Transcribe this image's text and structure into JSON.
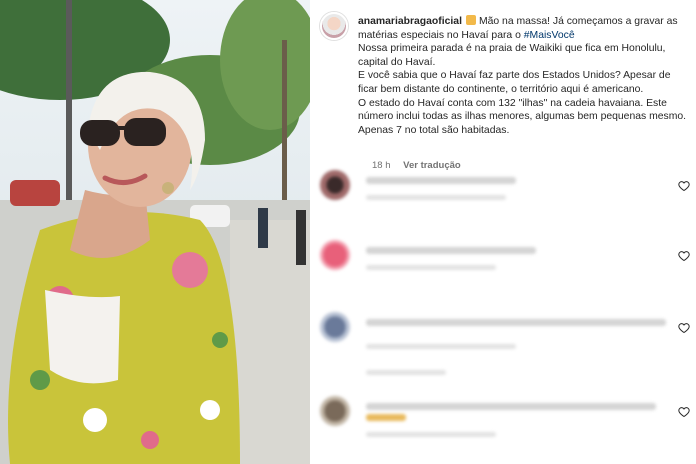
{
  "post": {
    "username": "anamariabragaoficial",
    "caption_lines": [
      "Mão na massa! Já começamos a gravar as matérias especiais no Havaí para o ",
      "Nossa primeira parada é na praia de Waikiki que fica em Honolulu, capital do Havaí.",
      "E você sabia que o Havaí faz parte dos Estados Unidos? Apesar de ficar bem distante do continente, o território aqui é americano.",
      "O estado do Havaí conta com 132 \"ilhas\" na cadeia havaiana. Este número inclui todas as ilhas menores, algumas bem pequenas mesmo. Apenas 7 no total são habitadas."
    ],
    "hashtag": "#MaisVocê",
    "time_ago": "18 h",
    "translate_label": "Ver tradução"
  },
  "colors": {
    "hashtag": "#00376b",
    "muted": "#737373",
    "text": "#262626"
  },
  "icons": {
    "like": "heart-outline-icon"
  }
}
